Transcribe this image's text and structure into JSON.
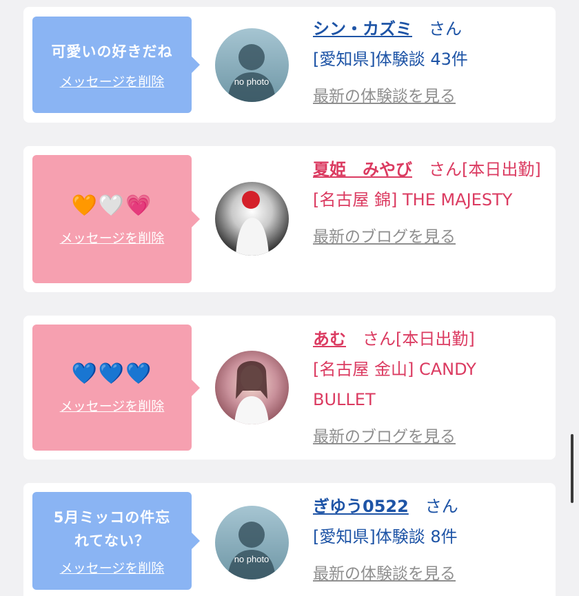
{
  "messages": [
    {
      "bubble_text": "可愛いの好きだね",
      "delete_label": "メッセージを削除",
      "name": "シン・カズミ",
      "suffix": "さん",
      "line1": "[愛知県]体験談 43件",
      "line2": "",
      "avatar_text": "no photo",
      "link": "最新の体験談を見る"
    },
    {
      "bubble_text": "🧡🤍💗",
      "delete_label": "メッセージを削除",
      "name": "夏姫　みやび",
      "suffix": "さん[本日出勤]",
      "line1": "[名古屋 錦] THE MAJESTY",
      "line2": "",
      "avatar_text": "",
      "link": "最新のブログを見る"
    },
    {
      "bubble_text": "💙💙💙",
      "delete_label": "メッセージを削除",
      "name": "あむ",
      "suffix": "さん[本日出勤]",
      "line1": "[名古屋 金山] CANDY BULLET",
      "line2": "",
      "avatar_text": "",
      "link": "最新のブログを見る"
    },
    {
      "bubble_text": "5月ミッコの件忘れてない？",
      "delete_label": "メッセージを削除",
      "name": "ぎゆう0522",
      "suffix": "さん",
      "line1": "[愛知県]体験談 8件",
      "line2": "",
      "avatar_text": "no photo",
      "link": "最新の体験談を見る"
    }
  ],
  "colors": {
    "bubble_blue": "#8ab4f3",
    "bubble_pink": "#f6a0b0",
    "name_blue": "#1e54a6",
    "name_pink": "#db3b61",
    "link_gray": "#8f8f8f"
  }
}
